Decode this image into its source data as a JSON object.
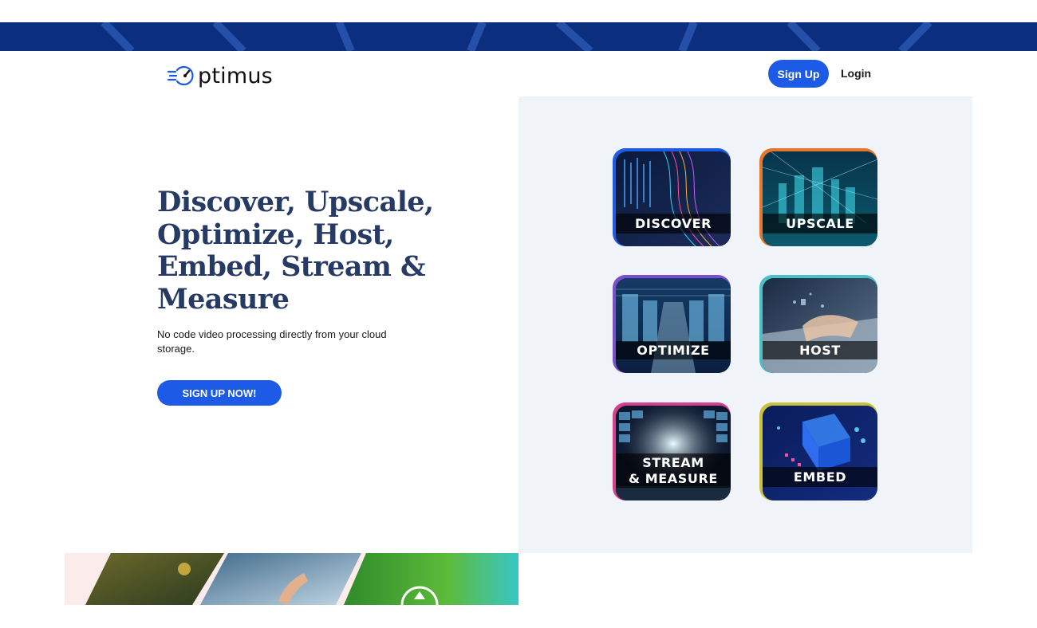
{
  "brand": {
    "logo_text": "ptimus",
    "logo_icon": "speedometer-o-icon",
    "primary_color": "#1d5be6",
    "banner_color": "#0b2f7e",
    "heading_color": "#273a63"
  },
  "nav": {
    "signup_label": "Sign Up",
    "login_label": "Login"
  },
  "hero": {
    "title": "Discover, Upscale, Optimize, Host, Embed, Stream & Measure",
    "subtitle": "No code video processing directly from your cloud storage.",
    "cta_label": "SIGN UP NOW!"
  },
  "tiles": [
    {
      "label": "DISCOVER",
      "accent": "#1d5be6"
    },
    {
      "label": "UPSCALE",
      "accent": "#e8772e"
    },
    {
      "label": "OPTIMIZE",
      "accent": "#7a4fc9"
    },
    {
      "label": "HOST",
      "accent": "#4cc1c4"
    },
    {
      "label": "STREAM",
      "label2": "& MEASURE",
      "accent": "#d83f8a"
    },
    {
      "label": "EMBED",
      "accent": "#c9c13a"
    }
  ]
}
